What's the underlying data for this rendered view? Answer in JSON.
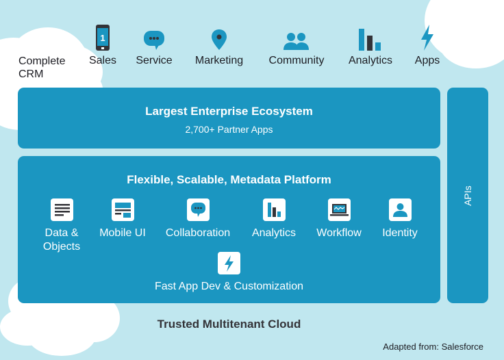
{
  "colors": {
    "background": "#c0e7ef",
    "panel": "#1b96c1",
    "icon_blue": "#1b96c1",
    "icon_dark": "#333338",
    "cloud": "#ffffff"
  },
  "top_row": {
    "crm_label_line1": "Complete",
    "crm_label_line2": "CRM",
    "items": [
      {
        "label": "Sales",
        "icon": "phone-icon"
      },
      {
        "label": "Service",
        "icon": "chat-bubble-icon"
      },
      {
        "label": "Marketing",
        "icon": "map-pin-icon"
      },
      {
        "label": "Community",
        "icon": "people-icon"
      },
      {
        "label": "Analytics",
        "icon": "bar-chart-icon"
      },
      {
        "label": "Apps",
        "icon": "lightning-icon"
      }
    ],
    "phone_badge": "1"
  },
  "ecosystem": {
    "title": "Largest Enterprise Ecosystem",
    "subtitle": "2,700+ Partner Apps"
  },
  "platform": {
    "title": "Flexible, Scalable, Metadata Platform",
    "capabilities": [
      {
        "label_line1": "Data &",
        "label_line2": "Objects",
        "icon": "document-lines-icon"
      },
      {
        "label_line1": "Mobile UI",
        "label_line2": "",
        "icon": "layout-icon"
      },
      {
        "label_line1": "Collaboration",
        "label_line2": "",
        "icon": "chat-bubble-icon"
      },
      {
        "label_line1": "Analytics",
        "label_line2": "",
        "icon": "bar-chart-icon"
      },
      {
        "label_line1": "Workflow",
        "label_line2": "",
        "icon": "laptop-icon"
      },
      {
        "label_line1": "Identity",
        "label_line2": "",
        "icon": "user-icon"
      }
    ],
    "bottom_capability": {
      "label": "Fast App Dev & Customization",
      "icon": "lightning-icon"
    }
  },
  "api": {
    "label": "APIs"
  },
  "foundation": {
    "title": "Trusted Multitenant Cloud"
  },
  "credit": "Adapted from: Salesforce"
}
